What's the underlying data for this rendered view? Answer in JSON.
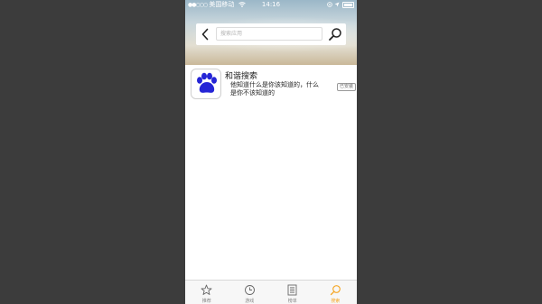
{
  "status_bar": {
    "signal": "●●○○○",
    "carrier": "美国移动",
    "time": "14:16"
  },
  "search": {
    "placeholder": "搜索应用",
    "back_icon": "chevron-left-icon",
    "search_icon": "magnifier-icon"
  },
  "results": [
    {
      "name": "和谐搜索",
      "description": "他知道什么是你该知道的，什么是你不该知道的",
      "badge": "已安装",
      "icon": "paw-icon",
      "icon_color": "#2525d6"
    }
  ],
  "tabs": [
    {
      "label": "推荐",
      "icon": "star-icon",
      "active": false
    },
    {
      "label": "游戏",
      "icon": "clock-icon",
      "active": false
    },
    {
      "label": "榜单",
      "icon": "list-icon",
      "active": false
    },
    {
      "label": "搜索",
      "icon": "search-icon",
      "active": true
    }
  ],
  "colors": {
    "accent": "#f5a623",
    "background": "#3c3c3c"
  }
}
